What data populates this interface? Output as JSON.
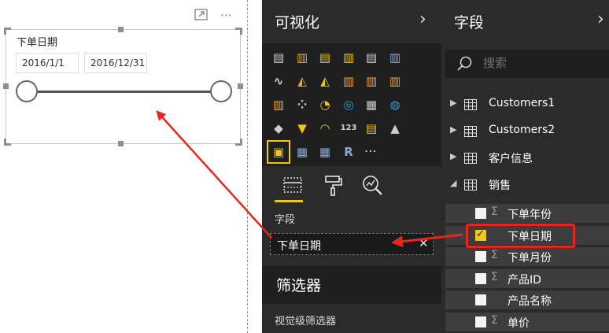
{
  "canvas": {
    "slicer": {
      "title": "下单日期",
      "start_date": "2016/1/1",
      "end_date": "2016/12/31",
      "range_start_fraction": 0.0,
      "range_end_fraction": 1.0
    },
    "focus_icon": "focus-mode-icon",
    "more_icon": "⋯"
  },
  "viz_pane": {
    "title": "可视化",
    "collapse_icon": "›",
    "visuals": [
      {
        "name": "stacked-bar-chart",
        "sym": "▤",
        "color": "#cfcfcf"
      },
      {
        "name": "stacked-column-chart",
        "sym": "▥",
        "color": "#f2a33a"
      },
      {
        "name": "clustered-bar-chart",
        "sym": "▤",
        "color": "#f2c811"
      },
      {
        "name": "clustered-column-chart",
        "sym": "▥",
        "color": "#f2c811"
      },
      {
        "name": "100-stacked-bar-chart",
        "sym": "▤",
        "color": "#cfcfcf"
      },
      {
        "name": "100-stacked-column-chart",
        "sym": "▥",
        "color": "#8aa8d8"
      },
      {
        "name": "line-chart",
        "sym": "∿",
        "color": "#cfcfcf"
      },
      {
        "name": "area-chart",
        "sym": "◭",
        "color": "#f2a33a"
      },
      {
        "name": "stacked-area-chart",
        "sym": "◭",
        "color": "#f2c811"
      },
      {
        "name": "line-and-stacked-column-chart",
        "sym": "▥",
        "color": "#f2a33a"
      },
      {
        "name": "line-and-clustered-column-chart",
        "sym": "▥",
        "color": "#f2a33a"
      },
      {
        "name": "ribbon-chart",
        "sym": "▥",
        "color": "#f2a33a"
      },
      {
        "name": "waterfall-chart",
        "sym": "▥",
        "color": "#f2a33a"
      },
      {
        "name": "scatter-chart",
        "sym": "⁘",
        "color": "#cfcfcf"
      },
      {
        "name": "pie-chart",
        "sym": "◔",
        "color": "#f2c811"
      },
      {
        "name": "donut-chart",
        "sym": "◎",
        "color": "#2fa0e6"
      },
      {
        "name": "treemap",
        "sym": "▦",
        "color": "#cfcfcf"
      },
      {
        "name": "map",
        "sym": "◍",
        "color": "#2fa0e6"
      },
      {
        "name": "filled-map",
        "sym": "◆",
        "color": "#cfcfcf"
      },
      {
        "name": "funnel",
        "sym": "▼",
        "color": "#f2c811"
      },
      {
        "name": "gauge",
        "sym": "◠",
        "color": "#f2c811"
      },
      {
        "name": "card",
        "sym": "123",
        "color": "#cfcfcf"
      },
      {
        "name": "multi-row-card",
        "sym": "▤",
        "color": "#f2c811"
      },
      {
        "name": "kpi",
        "sym": "▲",
        "color": "#cfcfcf"
      },
      {
        "name": "slicer",
        "sym": "▣",
        "color": "#f2c811"
      },
      {
        "name": "table",
        "sym": "▦",
        "color": "#8aa8d8"
      },
      {
        "name": "matrix",
        "sym": "▦",
        "color": "#8aa8d8"
      },
      {
        "name": "r-script-visual",
        "sym": "R",
        "color": "#8aa8d8"
      }
    ],
    "more_visuals": "⋯",
    "tabs": [
      "fields-tab",
      "format-tab",
      "analytics-tab"
    ],
    "well": {
      "label": "字段",
      "field": "下单日期",
      "remove_icon": "✕"
    },
    "filters_title": "筛选器",
    "visual_filters_label": "视觉级筛选器"
  },
  "fields_pane": {
    "title": "字段",
    "collapse_icon": "›",
    "search_placeholder": "搜索",
    "tables": [
      {
        "name": "Customers1",
        "expanded": false
      },
      {
        "name": "Customers2",
        "expanded": false
      },
      {
        "name": "客户信息",
        "expanded": false
      },
      {
        "name": "销售",
        "expanded": true
      }
    ],
    "fields": [
      {
        "name": "下单年份",
        "sigma": "Σ",
        "checked": false
      },
      {
        "name": "下单日期",
        "sigma": "",
        "checked": true
      },
      {
        "name": "下单月份",
        "sigma": "Σ",
        "checked": false
      },
      {
        "name": "产品ID",
        "sigma": "Σ",
        "checked": false
      },
      {
        "name": "产品名称",
        "sigma": "",
        "checked": false
      },
      {
        "name": "单价",
        "sigma": "Σ",
        "checked": false
      }
    ]
  },
  "colors": {
    "accent": "#f2c811",
    "annotation": "#e8261c",
    "pane_dark": "#2b2b2b"
  }
}
